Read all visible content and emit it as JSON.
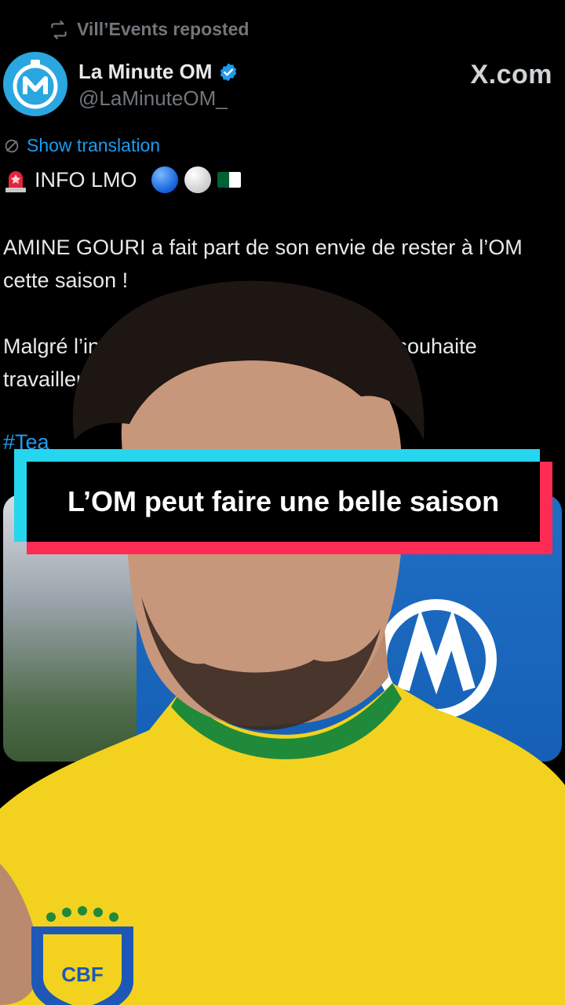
{
  "repost": {
    "label": "Vill’Events reposted",
    "icon": "repost-icon"
  },
  "author": {
    "display_name": "La Minute OM",
    "handle": "@LaMinuteOM_",
    "verified": true
  },
  "source": {
    "label": "X.com"
  },
  "translate": {
    "label": "Show translation",
    "icon": "globe-slash-icon"
  },
  "tweet": {
    "header": "INFO LMO",
    "p1": "AMINE GOURI a fait part de son envie de rester à l’OM cette saison !",
    "p2_left": "Malgré l’inté",
    "p2_right": "l souhaite",
    "p3": "travailler",
    "hashtag": "#Tea"
  },
  "caption": {
    "text": "L’OM peut faire une belle saison"
  },
  "colors": {
    "background": "#000000",
    "link_blue": "#1d9bf0",
    "muted_gray": "#71767b",
    "caption_cyan": "#26d6ee",
    "caption_red": "#fe2c55",
    "jersey_yellow": "#f2d21f",
    "jersey_green": "#1f8a3a"
  }
}
